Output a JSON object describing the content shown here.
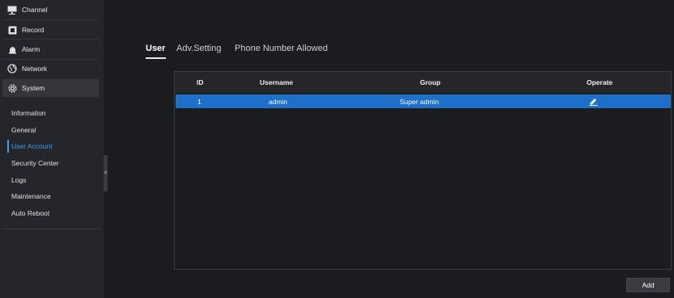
{
  "sidebar": {
    "menu": [
      {
        "label": "Channel",
        "icon": "channel-icon"
      },
      {
        "label": "Record",
        "icon": "record-icon"
      },
      {
        "label": "Alarm",
        "icon": "alarm-icon"
      },
      {
        "label": "Network",
        "icon": "network-icon"
      },
      {
        "label": "System",
        "icon": "system-gear-icon"
      }
    ],
    "submenu": [
      "Information",
      "General",
      "User Account",
      "Security Center",
      "Logs",
      "Maintenance",
      "Auto Reboot"
    ],
    "active_submenu": "User Account",
    "collapse_glyph": "<"
  },
  "tabs": [
    "User",
    "Adv.Setting",
    "Phone Number Allowed"
  ],
  "active_tab": "User",
  "table": {
    "headers": [
      "ID",
      "Username",
      "Group",
      "Operate"
    ],
    "rows": [
      {
        "id": "1",
        "username": "admin",
        "group": "Super admin",
        "operate": "edit-icon"
      }
    ]
  },
  "add_label": "Add",
  "colors": {
    "accent": "#3e9cf3",
    "selected_row": "#1d6fc8",
    "sidebar_bg": "#25262b",
    "page_bg": "#1b1c20"
  }
}
